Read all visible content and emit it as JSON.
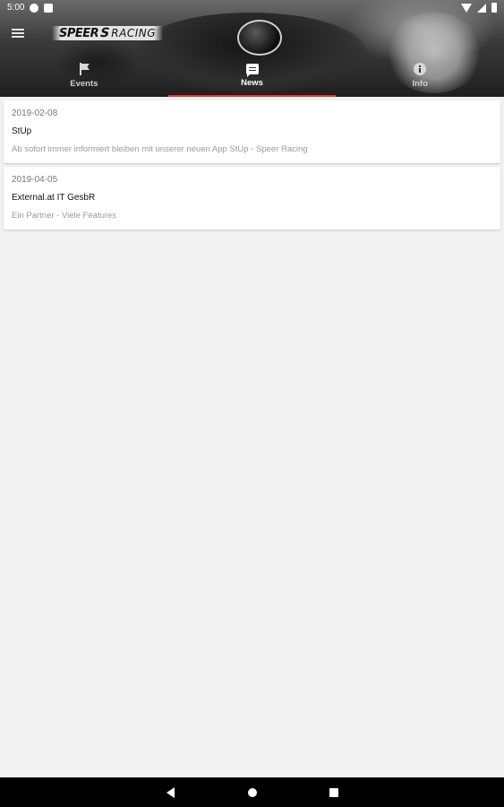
{
  "status_bar": {
    "time": "5:00",
    "left_icons": [
      "camera-badge-icon",
      "sim-card-icon"
    ],
    "right_icons": [
      "wifi-icon",
      "signal-icon",
      "battery-icon"
    ]
  },
  "toolbar": {
    "menu_icon": "hamburger-menu-icon",
    "logo": {
      "part1": "SPEER",
      "part2": "S",
      "part3": "RACING"
    }
  },
  "tabs": [
    {
      "label": "Events",
      "icon": "flag-icon",
      "active": false
    },
    {
      "label": "News",
      "icon": "chat-icon",
      "active": true
    },
    {
      "label": "Info",
      "icon": "info-icon",
      "active": false
    }
  ],
  "accent_color": "#e53935",
  "news": [
    {
      "date": "2019-02-08",
      "title": "StUp",
      "text": "Ab sofort immer informiert bleiben mit unserer neuen App StUp - Speer Racing"
    },
    {
      "date": "2019-04-05",
      "title": "External.at IT GesbR",
      "text": "Ein Partner - Viele Features"
    }
  ],
  "nav_bar": {
    "buttons": [
      "back-icon",
      "home-icon",
      "recent-apps-icon"
    ]
  }
}
